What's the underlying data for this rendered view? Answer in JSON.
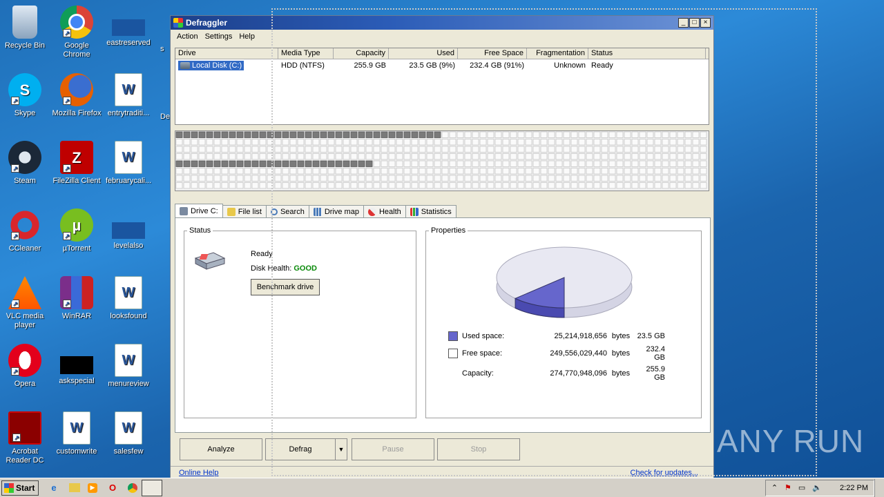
{
  "desktop": {
    "icons": [
      {
        "label": "Recycle Bin",
        "icon": "recycle-bin-icon"
      },
      {
        "label": "Google Chrome",
        "icon": "chrome-icon"
      },
      {
        "label": "eastreserved",
        "icon": "blank-file-icon"
      },
      {
        "label": "Skype",
        "icon": "skype-icon"
      },
      {
        "label": "Mozilla Firefox",
        "icon": "firefox-icon"
      },
      {
        "label": "entrytraditi...",
        "icon": "word-doc-icon"
      },
      {
        "label": "Steam",
        "icon": "steam-icon"
      },
      {
        "label": "FileZilla Client",
        "icon": "filezilla-icon"
      },
      {
        "label": "februarycali...",
        "icon": "word-doc-icon"
      },
      {
        "label": "CCleaner",
        "icon": "ccleaner-icon"
      },
      {
        "label": "µTorrent",
        "icon": "utorrent-icon"
      },
      {
        "label": "levelalso",
        "icon": "blank-file-icon"
      },
      {
        "label": "VLC media player",
        "icon": "vlc-icon"
      },
      {
        "label": "WinRAR",
        "icon": "winrar-icon"
      },
      {
        "label": "looksfound",
        "icon": "word-doc-icon"
      },
      {
        "label": "Opera",
        "icon": "opera-icon"
      },
      {
        "label": "askspecial",
        "icon": "black-file-icon"
      },
      {
        "label": "menureview",
        "icon": "word-doc-icon"
      },
      {
        "label": "Acrobat Reader DC",
        "icon": "acrobat-icon"
      },
      {
        "label": "customwrite",
        "icon": "word-doc-icon"
      },
      {
        "label": "salesfew",
        "icon": "word-doc-icon"
      }
    ],
    "partial_labels": {
      "row1": "s",
      "row3": "De"
    }
  },
  "window": {
    "title": "Defraggler",
    "buttons": {
      "minimize": "_",
      "maximize": "□",
      "close": "×"
    },
    "menu": [
      "Action",
      "Settings",
      "Help"
    ]
  },
  "drive_list": {
    "headers": [
      "Drive",
      "Media Type",
      "Capacity",
      "Used",
      "Free Space",
      "Fragmentation",
      "Status"
    ],
    "rows": [
      {
        "drive": "Local Disk (C:)",
        "media": "HDD (NTFS)",
        "capacity": "255.9 GB",
        "used": "23.5 GB (9%)",
        "free": "232.4 GB (91%)",
        "fragmentation": "Unknown",
        "status": "Ready"
      }
    ]
  },
  "drive_map": {
    "used_blocks_row1": 35,
    "used_blocks_row5": 26
  },
  "tabs": [
    "Drive C:",
    "File list",
    "Search",
    "Drive map",
    "Health",
    "Statistics"
  ],
  "status_panel": {
    "legend": "Status",
    "state": "Ready",
    "health_label": "Disk Health:",
    "health_value": "GOOD",
    "benchmark_button": "Benchmark drive"
  },
  "properties_panel": {
    "legend": "Properties",
    "used_fraction": 0.092,
    "rows": [
      {
        "label": "Used space:",
        "bytes": "25,214,918,656",
        "unit": "bytes",
        "gb": "23.5 GB"
      },
      {
        "label": "Free space:",
        "bytes": "249,556,029,440",
        "unit": "bytes",
        "gb": "232.4 GB"
      },
      {
        "label": "Capacity:",
        "bytes": "274,770,948,096",
        "unit": "bytes",
        "gb": "255.9 GB"
      }
    ],
    "colors": {
      "used": "#6666cc",
      "free": "#ffffff"
    }
  },
  "actions": {
    "analyze": "Analyze",
    "defrag": "Defrag",
    "pause": "Pause",
    "stop": "Stop"
  },
  "statusbar": {
    "online_help": "Online Help",
    "check_updates": "Check for updates..."
  },
  "watermark": "ANY RUN",
  "taskbar": {
    "start": "Start",
    "clock": "2:22 PM"
  }
}
